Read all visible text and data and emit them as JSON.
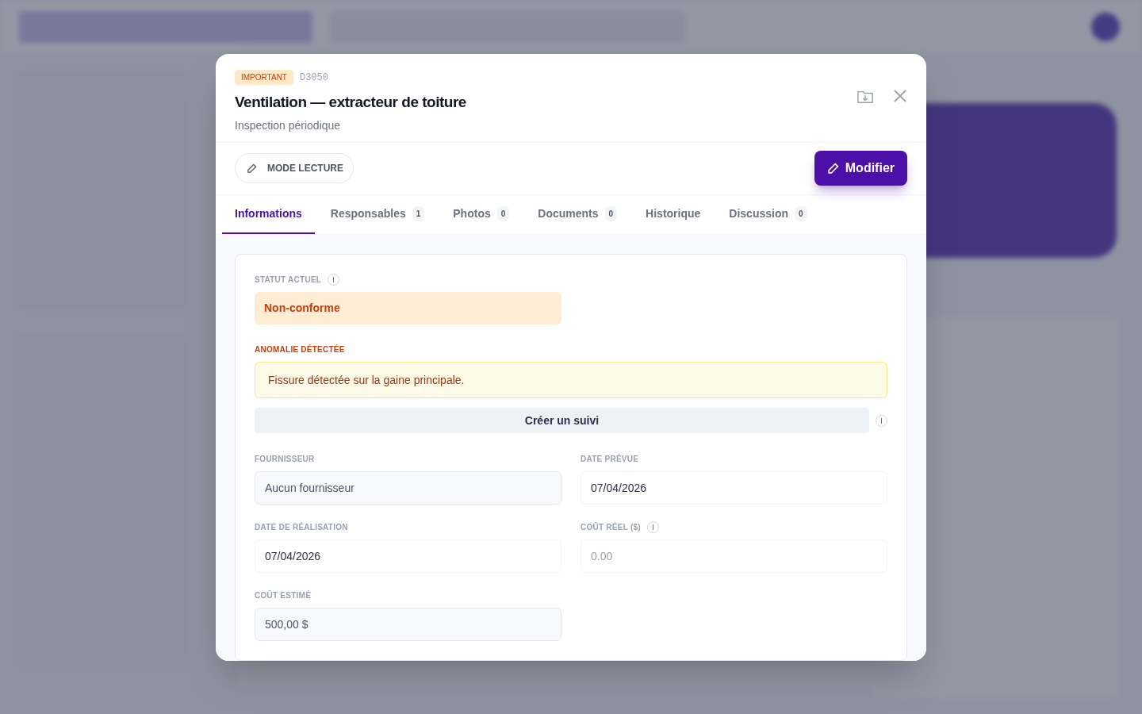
{
  "modal": {
    "badge": "IMPORTANT",
    "code": "D3050",
    "title": "Ventilation — extracteur de toiture",
    "subtitle": "Inspection périodique",
    "mode_button": "MODE LECTURE",
    "edit_button": "Modifier",
    "tabs": [
      {
        "label": "Informations",
        "selected": true
      },
      {
        "label": "Responsables",
        "count": "1",
        "selected": false
      },
      {
        "label": "Photos",
        "count": "0",
        "selected": false
      },
      {
        "label": "Documents",
        "count": "0",
        "selected": false
      },
      {
        "label": "Historique",
        "selected": false
      },
      {
        "label": "Discussion",
        "count": "0",
        "selected": false
      }
    ],
    "status": {
      "label": "STATUT ACTUEL",
      "value": "Non-conforme"
    },
    "anomaly": {
      "label": "ANOMALIE DÉTECTÉE",
      "text": "Fissure détectée sur la gaine principale."
    },
    "follow_up_button": "Créer un suivi",
    "fields": [
      {
        "label": "FOURNISSEUR",
        "value": "Aucun fournisseur",
        "kind": "readonly",
        "info": false
      },
      {
        "label": "DATE PRÉVUE",
        "value": "07/04/2026",
        "kind": "input",
        "info": false
      },
      {
        "label": "DATE DE RÉALISATION",
        "value": "07/04/2026",
        "kind": "input",
        "info": false
      },
      {
        "label": "COÛT RÉEL ($)",
        "placeholder": "0.00",
        "kind": "input",
        "info": true
      },
      {
        "label": "COÛT ESTIMÉ",
        "value": "500,00 $",
        "kind": "readonly",
        "info": false
      }
    ]
  }
}
